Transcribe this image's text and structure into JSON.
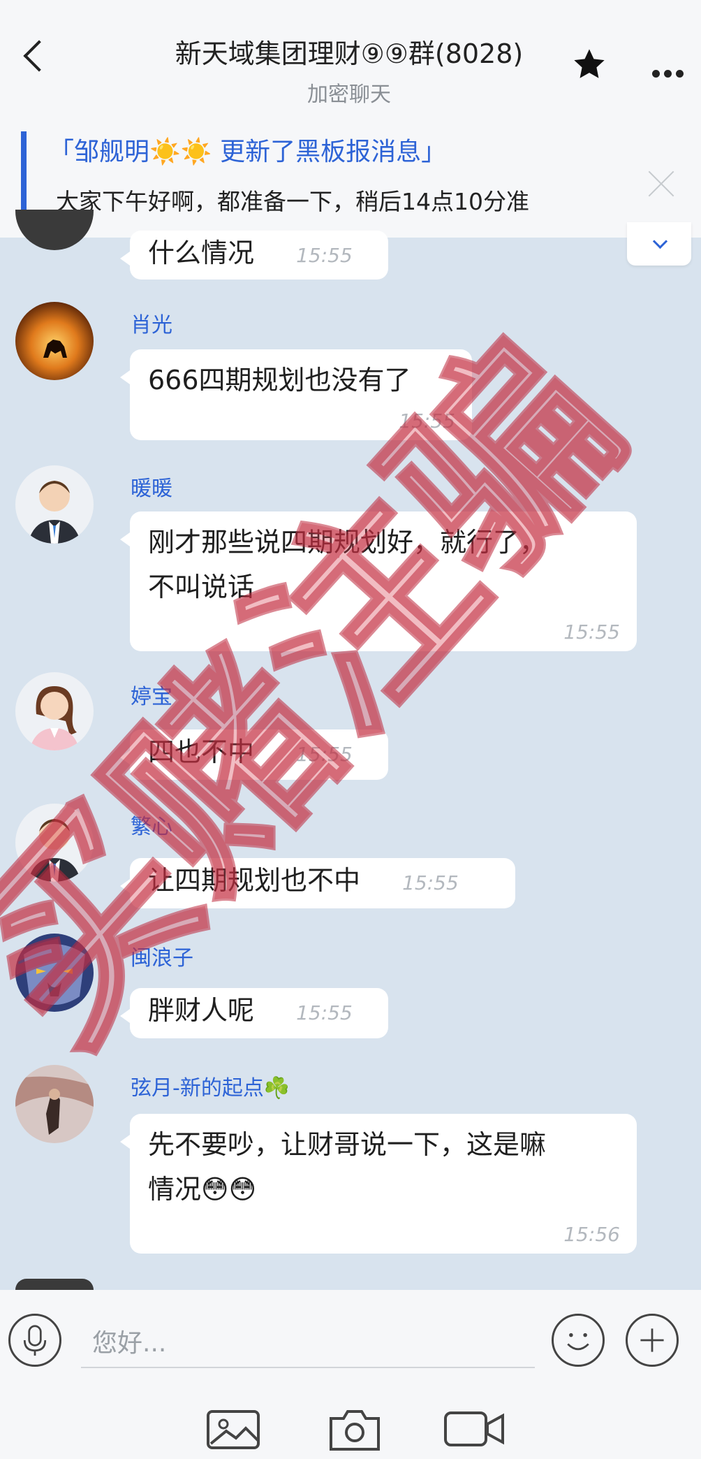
{
  "header": {
    "title": "新天域集团理财⑨⑨群(8028)",
    "subtitle": "加密聊天"
  },
  "notice": {
    "title": "「邹舰明☀️☀️ 更新了黑板报消息」",
    "text": "大家下午好啊，都准备一下，稍后14点10分准"
  },
  "messages": [
    {
      "name": "",
      "text": "什么情况",
      "time": "15:55"
    },
    {
      "name": "肖光",
      "text": "666四期规划也没有了",
      "time": "15:55"
    },
    {
      "name": "暖暖",
      "text_line1": "刚才那些说四期规划好，就行了，",
      "text_line2": "不叫说话",
      "time": "15:55"
    },
    {
      "name": "婷宝",
      "text": "四也不中",
      "time": "15:55"
    },
    {
      "name": "繁心",
      "text": "让四期规划也不中",
      "time": "15:55"
    },
    {
      "name": "闽浪子",
      "text": "胖财人呢",
      "time": "15:55"
    },
    {
      "name": "弦月-新的起点☘️",
      "text_line1": "先不要吵，让财哥说一下，这是嘛",
      "text_line2": "情况😳😳",
      "time": "15:56"
    }
  ],
  "input": {
    "placeholder": "您好..."
  },
  "watermark": "买赌注骗",
  "colors": {
    "accent": "#2d63d6",
    "chat_bg": "#d8e3ee",
    "bubble": "#ffffff"
  }
}
